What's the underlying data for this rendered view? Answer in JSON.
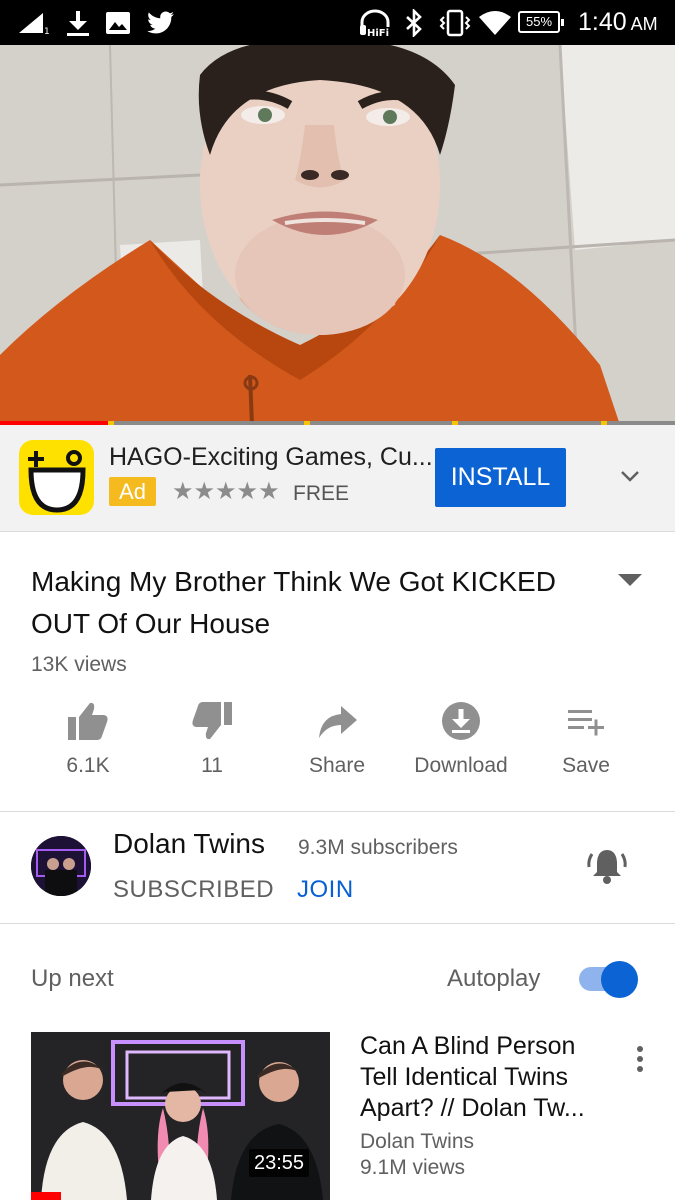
{
  "status_bar": {
    "battery": "55%",
    "time": "1:40",
    "ampm": "AM",
    "icons": [
      "signal-icon",
      "download-icon",
      "image-icon",
      "twitter-icon",
      "hifi-headphones-icon",
      "bluetooth-icon",
      "vibrate-icon",
      "wifi-icon",
      "battery-icon"
    ]
  },
  "player": {
    "progress_fraction": 0.16,
    "ad_marker_fractions": [
      0.16,
      0.45,
      0.67,
      0.89
    ]
  },
  "ad": {
    "app_name": "HAGO-Exciting Games, Cu...",
    "badge": "Ad",
    "stars": "★★★★★",
    "rating": 4.5,
    "price": "FREE",
    "install_label": "INSTALL",
    "colors": {
      "install": "#0b63d4",
      "badge": "#f5bb1e",
      "icon_bg": "#ffe100"
    }
  },
  "video": {
    "title": "Making My Brother Think We Got KICKED OUT Of Our House",
    "views": "13K views"
  },
  "actions": {
    "like": "6.1K",
    "dislike": "11",
    "share": "Share",
    "download": "Download",
    "save": "Save"
  },
  "channel": {
    "name": "Dolan Twins",
    "subscribers": "9.3M subscribers",
    "subscribed_label": "SUBSCRIBED",
    "join_label": "JOIN"
  },
  "up_next": {
    "label": "Up next",
    "autoplay_label": "Autoplay",
    "autoplay_on": true
  },
  "next_video": {
    "title": "Can A Blind Person Tell Identical Twins Apart? // Dolan Tw...",
    "channel": "Dolan Twins",
    "views": "9.1M views",
    "duration": "23:55"
  }
}
